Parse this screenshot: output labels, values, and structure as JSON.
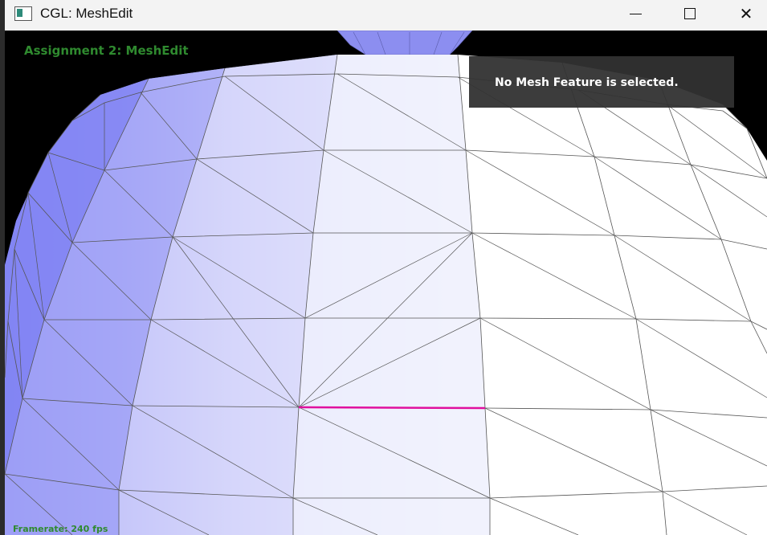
{
  "window": {
    "title": "CGL: MeshEdit",
    "minimize_icon": "minimize-icon",
    "maximize_icon": "maximize-icon",
    "close_icon": "close-icon",
    "close_glyph": "✕"
  },
  "hud": {
    "assignment_title": "Assignment 2: MeshEdit",
    "selection_status": "No Mesh Feature is selected.",
    "framerate": "Framerate: 240 fps"
  },
  "colors": {
    "hud_text": "#2f8a2f",
    "highlight_edge": "#e0109e",
    "panel_bg": "#323232"
  }
}
